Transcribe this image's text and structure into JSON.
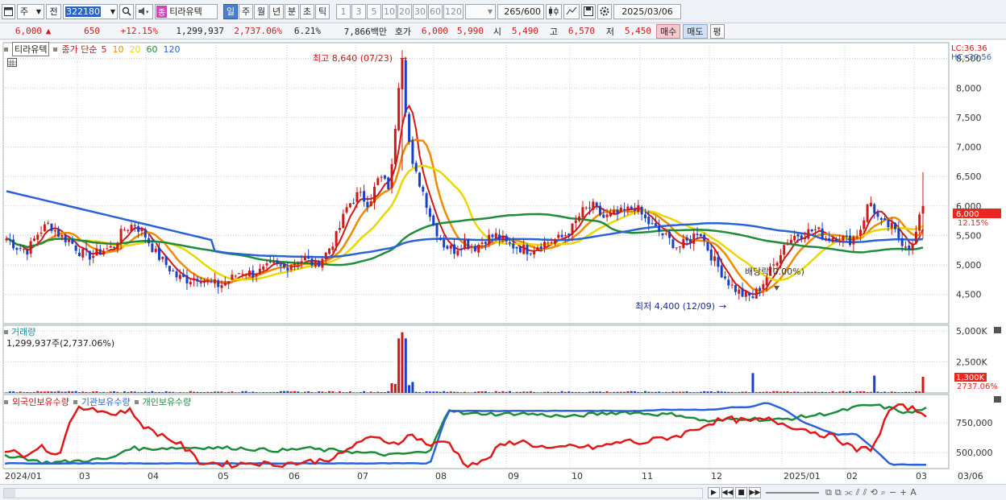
{
  "toolbar": {
    "period_type": "주",
    "prev_label": "전",
    "code": "322180",
    "stock_badge": "종",
    "stock_name": "티라유텍",
    "period_tabs": [
      "일",
      "주",
      "월",
      "년",
      "분",
      "초",
      "틱"
    ],
    "interval_buttons": [
      "1",
      "3",
      "5",
      "10",
      "20",
      "30",
      "60",
      "120"
    ],
    "count": "265",
    "count_total": "/600",
    "date": "2025/03/06"
  },
  "info": {
    "price": "6,000",
    "arrow": "▲",
    "change": "650",
    "change_pct": "+12.15%",
    "volume": "1,299,937",
    "volume_pct": "2,737.06%",
    "turnover": "6.21%",
    "amount": "7,866백만",
    "quote_label": "호가",
    "ask": "6,000",
    "bid": "5,990",
    "open_label": "시",
    "open": "5,490",
    "high_label": "고",
    "high": "6,570",
    "low_label": "저",
    "low": "5,450",
    "buy_label": "매수",
    "sell_label": "매도",
    "eval_label": "평"
  },
  "legend": {
    "name": "티라유텍",
    "ma_title": "종가 단순",
    "ma": [
      {
        "label": "5",
        "color": "#d01818"
      },
      {
        "label": "10",
        "color": "#f08a00"
      },
      {
        "label": "20",
        "color": "#e8d800"
      },
      {
        "label": "60",
        "color": "#1e8c3a"
      },
      {
        "label": "120",
        "color": "#2a62d8"
      }
    ]
  },
  "annotations": {
    "high": "최고 8,640 (07/23)",
    "low": "최저 4,400 (12/09)",
    "dividend": "배당락(0.00%)"
  },
  "corner": {
    "lc": "LC:36.36",
    "hc": "HC:-30.56"
  },
  "price_badge": {
    "value": "6,000",
    "pct": "12.15%"
  },
  "volume_panel": {
    "title": "거래량",
    "value": "1,299,937주(2,737.06%)",
    "badge": "1,300K",
    "badge_pct": "2737.06%"
  },
  "holdings_panel": {
    "series": [
      {
        "label": "외국인보유수량",
        "color": "#e01818"
      },
      {
        "label": "기관보유수량",
        "color": "#2a62d8"
      },
      {
        "label": "개인보유수량",
        "color": "#1e8c3a"
      }
    ]
  },
  "colors": {
    "up": "#d01818",
    "down": "#1840c8",
    "grid": "#c9ccd2"
  },
  "chart_data": [
    {
      "type": "candlestick",
      "title": "티라유텍",
      "y_ticks": [
        "8,500",
        "8,000",
        "7,500",
        "7,000",
        "6,500",
        "6,000",
        "5,500",
        "5,000",
        "4,500"
      ],
      "ylim": [
        4100,
        8700
      ],
      "x_ticks": [
        "2024/01",
        "03",
        "04",
        "05",
        "06",
        "07",
        "08",
        "09",
        "10",
        "11",
        "12",
        "2025/01",
        "02",
        "03",
        "03/06"
      ],
      "key_points": [
        {
          "date": "2024/07/23",
          "value": 8640,
          "label": "high"
        },
        {
          "date": "2024/12/09",
          "value": 4400,
          "label": "low"
        },
        {
          "date": "2025/03/06",
          "value": 6000,
          "label": "last"
        }
      ],
      "close_path": [
        5450,
        5300,
        5250,
        5550,
        5700,
        5500,
        5400,
        5200,
        5150,
        5250,
        5300,
        5600,
        5700,
        5500,
        5200,
        5000,
        4800,
        4750,
        4800,
        4700,
        4650,
        4750,
        4900,
        4850,
        4900,
        5000,
        4950,
        5050,
        5100,
        5000,
        5200,
        5500,
        6000,
        6200,
        6050,
        6500,
        6300,
        8500,
        6700,
        6300,
        5700,
        5350,
        5250,
        5400,
        5300,
        5450,
        5500,
        5350,
        5300,
        5250,
        5350,
        5400,
        5450,
        5600,
        5900,
        6000,
        5800,
        5850,
        5900,
        6000,
        5750,
        5600,
        5450,
        5300,
        5400,
        5600,
        5200,
        4900,
        4650,
        4500,
        4450,
        4700,
        5000,
        5350,
        5500,
        5550,
        5600,
        5450,
        5500,
        5400,
        5550,
        6100,
        5700,
        5650,
        5400,
        5300,
        6000
      ]
    },
    {
      "type": "bar",
      "title": "거래량",
      "y_ticks": [
        "5,000K",
        "2,500K"
      ],
      "note": "daily volume; spike around 2024/07/23 (~4,900K), last bar 1,300K"
    },
    {
      "type": "line",
      "title": "보유수량",
      "y_ticks": [
        "750,000",
        "500,000"
      ],
      "series": [
        {
          "name": "외국인보유수량"
        },
        {
          "name": "기관보유수량"
        },
        {
          "name": "개인보유수량"
        }
      ]
    }
  ]
}
